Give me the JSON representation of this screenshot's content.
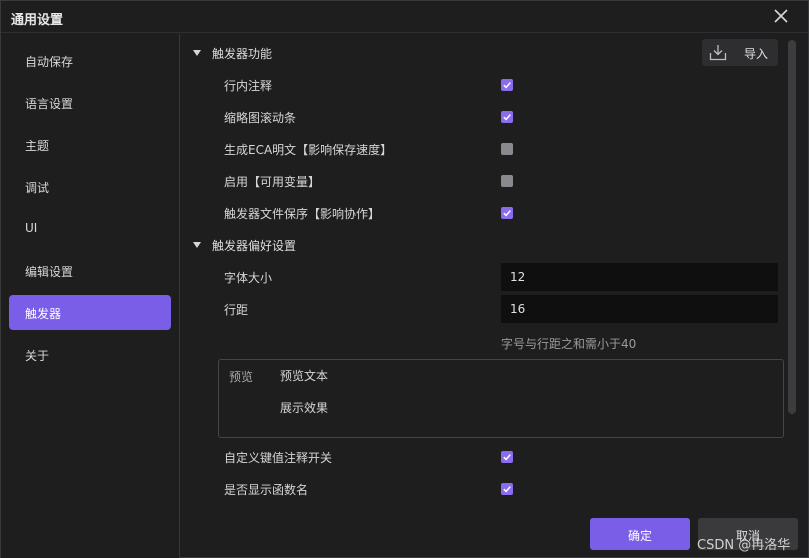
{
  "window": {
    "title": "通用设置"
  },
  "sidebar": {
    "items": [
      {
        "label": "自动保存"
      },
      {
        "label": "语言设置"
      },
      {
        "label": "主题"
      },
      {
        "label": "调试"
      },
      {
        "label": "UI"
      },
      {
        "label": "编辑设置"
      },
      {
        "label": "触发器",
        "active": true
      },
      {
        "label": "关于"
      }
    ]
  },
  "toolbar": {
    "import_label": "导入",
    "import_icon": "download-icon"
  },
  "section1": {
    "title": "触发器功能",
    "options": [
      {
        "label": "行内注释",
        "checked": true
      },
      {
        "label": "缩略图滚动条",
        "checked": true
      },
      {
        "label": "生成ECA明文【影响保存速度】",
        "checked": false
      },
      {
        "label": "启用【可用变量】",
        "checked": false
      },
      {
        "label": "触发器文件保序【影响协作】",
        "checked": true
      }
    ]
  },
  "section2": {
    "title": "触发器偏好设置",
    "font_size_label": "字体大小",
    "font_size_value": "12",
    "line_spacing_label": "行距",
    "line_spacing_value": "16",
    "hint": "字号与行距之和需小于40",
    "preview": {
      "label": "预览",
      "line1": "预览文本",
      "line2": "展示效果"
    },
    "options": [
      {
        "label": "自定义键值注释开关",
        "checked": true
      },
      {
        "label": "是否显示函数名",
        "checked": true
      }
    ]
  },
  "footer": {
    "ok_label": "确定",
    "cancel_label": "取消"
  },
  "watermark": "CSDN @冉洛华",
  "colors": {
    "accent": "#7b5ee8",
    "checkbox_on": "#8b6cf0",
    "checkbox_off": "#8a8a8e",
    "background": "#1e1e1f"
  }
}
